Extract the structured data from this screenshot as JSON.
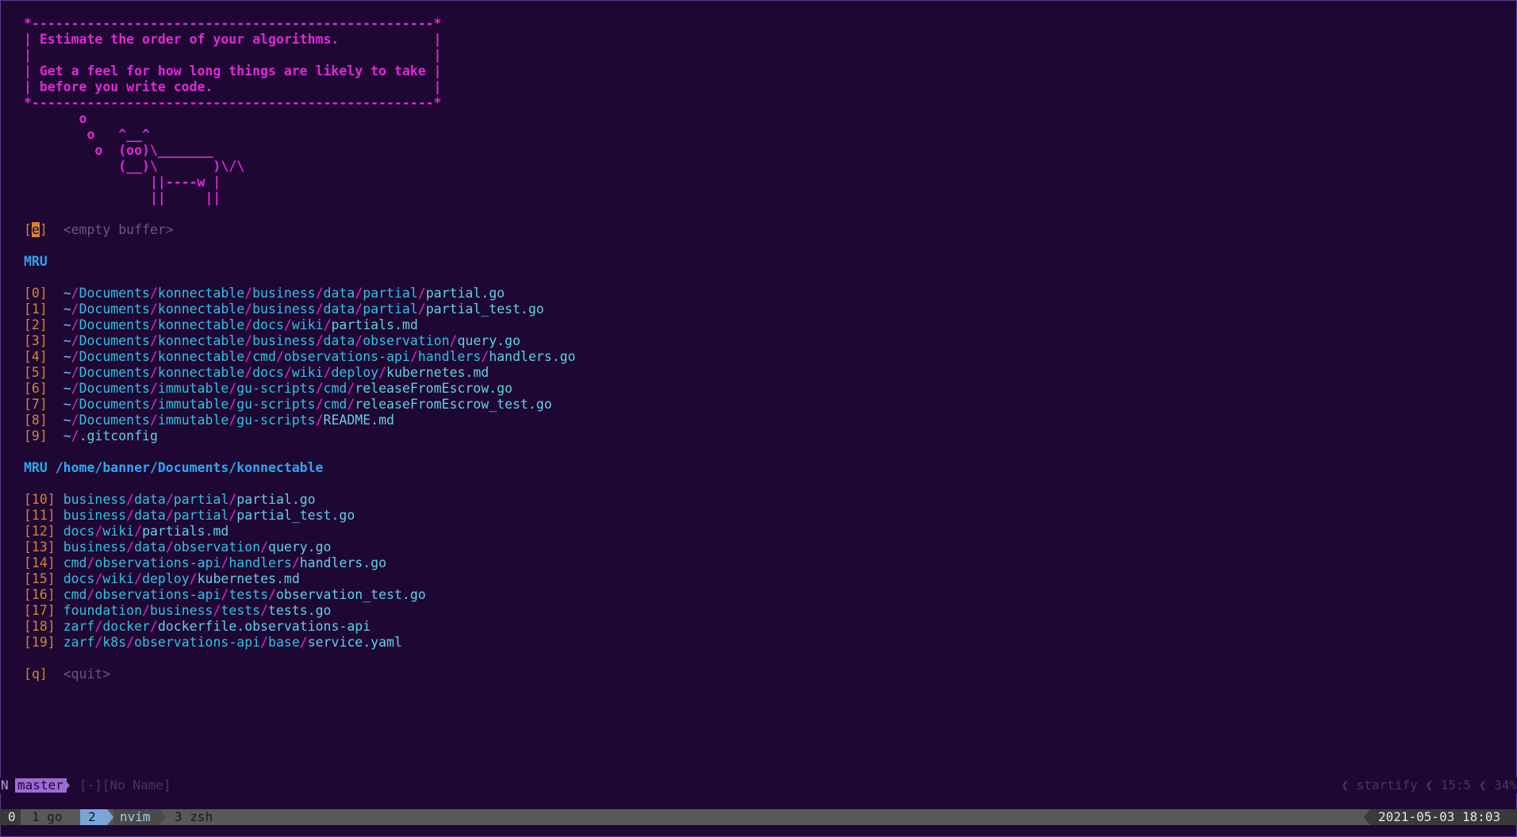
{
  "fortune": {
    "border": "*---------------------------------------------------*",
    "lines": [
      "| Estimate the order of your algorithms.            |",
      "|                                                   |",
      "| Get a feel for how long things are likely to take |",
      "| before you write code.                            |"
    ]
  },
  "cow": [
    "       o",
    "        o   ^__^",
    "         o  (oo)\\_______",
    "            (__)\\       )\\/\\",
    "                ||----w |",
    "                ||     ||"
  ],
  "empty_buffer": {
    "key": "e",
    "label": "<empty buffer>"
  },
  "mru": {
    "heading": "MRU",
    "items": [
      {
        "key": "0",
        "path": "~/Documents/konnectable/business/data/partial/partial.go"
      },
      {
        "key": "1",
        "path": "~/Documents/konnectable/business/data/partial/partial_test.go"
      },
      {
        "key": "2",
        "path": "~/Documents/konnectable/docs/wiki/partials.md"
      },
      {
        "key": "3",
        "path": "~/Documents/konnectable/business/data/observation/query.go"
      },
      {
        "key": "4",
        "path": "~/Documents/konnectable/cmd/observations-api/handlers/handlers.go"
      },
      {
        "key": "5",
        "path": "~/Documents/konnectable/docs/wiki/deploy/kubernetes.md"
      },
      {
        "key": "6",
        "path": "~/Documents/immutable/gu-scripts/cmd/releaseFromEscrow.go"
      },
      {
        "key": "7",
        "path": "~/Documents/immutable/gu-scripts/cmd/releaseFromEscrow_test.go"
      },
      {
        "key": "8",
        "path": "~/Documents/immutable/gu-scripts/README.md"
      },
      {
        "key": "9",
        "path": "~/.gitconfig"
      }
    ]
  },
  "mru_dir": {
    "heading": "MRU /home/banner/Documents/konnectable",
    "items": [
      {
        "key": "10",
        "path": "business/data/partial/partial.go"
      },
      {
        "key": "11",
        "path": "business/data/partial/partial_test.go"
      },
      {
        "key": "12",
        "path": "docs/wiki/partials.md"
      },
      {
        "key": "13",
        "path": "business/data/observation/query.go"
      },
      {
        "key": "14",
        "path": "cmd/observations-api/handlers/handlers.go"
      },
      {
        "key": "15",
        "path": "docs/wiki/deploy/kubernetes.md"
      },
      {
        "key": "16",
        "path": "cmd/observations-api/tests/observation_test.go"
      },
      {
        "key": "17",
        "path": "foundation/business/tests/tests.go"
      },
      {
        "key": "18",
        "path": "zarf/docker/dockerfile.observations-api"
      },
      {
        "key": "19",
        "path": "zarf/k8s/observations-api/base/service.yaml"
      }
    ]
  },
  "quit": {
    "key": "q",
    "label": "<quit>"
  },
  "statusline": {
    "mode": "N",
    "branch": "master",
    "buffer": "[-][No Name]",
    "filetype": "startify",
    "position": "15:5",
    "percent": "34%",
    "sep": "❮"
  },
  "tmux": {
    "session": "0",
    "windows": [
      {
        "index": "1",
        "name": "go"
      },
      {
        "index": "2",
        "name": "nvim"
      },
      {
        "index": "3",
        "name": "zsh"
      }
    ],
    "clock": "2021-05-03 18:03"
  },
  "colors": {
    "background": "#1f0733",
    "magenta": "#e028d8",
    "heading_blue": "#2aa8f0",
    "path_cyan": "#2fc1e3",
    "bracket_orange": "#d2843a",
    "tmux_bar": "#585858"
  }
}
